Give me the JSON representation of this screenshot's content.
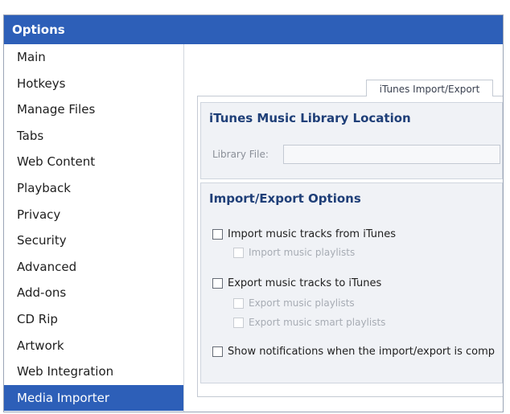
{
  "window": {
    "title": "Options"
  },
  "sidebar": {
    "items": [
      {
        "label": "Main",
        "selected": false
      },
      {
        "label": "Hotkeys",
        "selected": false
      },
      {
        "label": "Manage Files",
        "selected": false
      },
      {
        "label": "Tabs",
        "selected": false
      },
      {
        "label": "Web Content",
        "selected": false
      },
      {
        "label": "Playback",
        "selected": false
      },
      {
        "label": "Privacy",
        "selected": false
      },
      {
        "label": "Security",
        "selected": false
      },
      {
        "label": "Advanced",
        "selected": false
      },
      {
        "label": "Add-ons",
        "selected": false
      },
      {
        "label": "CD Rip",
        "selected": false
      },
      {
        "label": "Artwork",
        "selected": false
      },
      {
        "label": "Web Integration",
        "selected": false
      },
      {
        "label": "Media Importer",
        "selected": true
      }
    ]
  },
  "tabs": [
    {
      "label": "iTunes Import/Export",
      "active": true
    }
  ],
  "library_location": {
    "title": "iTunes Music Library Location",
    "file_label": "Library File:",
    "file_value": ""
  },
  "import_export": {
    "title": "Import/Export Options",
    "options": {
      "import_tracks": {
        "label": "Import music tracks from iTunes",
        "checked": false,
        "enabled": true
      },
      "import_playlists": {
        "label": "Import music playlists",
        "checked": false,
        "enabled": false
      },
      "export_tracks": {
        "label": "Export music tracks to iTunes",
        "checked": false,
        "enabled": true
      },
      "export_playlists": {
        "label": "Export music playlists",
        "checked": false,
        "enabled": false
      },
      "export_smart_playlists": {
        "label": "Export music smart playlists",
        "checked": false,
        "enabled": false
      },
      "show_notifications": {
        "label": "Show notifications when the import/export is comp",
        "checked": false,
        "enabled": true
      }
    }
  },
  "colors": {
    "titlebar": "#2d5fb8",
    "selection": "#2d5fb8",
    "group_title": "#1f3f78"
  }
}
